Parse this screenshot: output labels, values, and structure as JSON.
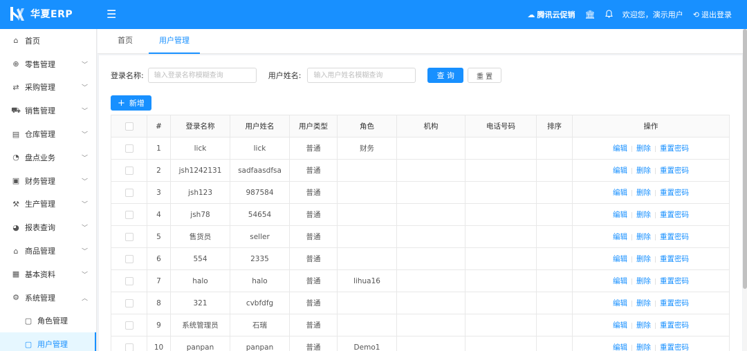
{
  "brand": {
    "name": "华夏ERP",
    "color": "#1890ff"
  },
  "header": {
    "promo_label": "腾讯云促销",
    "welcome": "欢迎您，演示用户",
    "logout_label": "退出登录"
  },
  "sidebar": {
    "items": [
      {
        "label": "首页",
        "icon": "home-icon",
        "has_arrow": false
      },
      {
        "label": "零售管理",
        "icon": "gift-icon",
        "has_arrow": true
      },
      {
        "label": "采购管理",
        "icon": "swap-icon",
        "has_arrow": true
      },
      {
        "label": "销售管理",
        "icon": "cart-icon",
        "has_arrow": true
      },
      {
        "label": "仓库管理",
        "icon": "warehouse-icon",
        "has_arrow": true
      },
      {
        "label": "盘点业务",
        "icon": "inventory-icon",
        "has_arrow": true
      },
      {
        "label": "财务管理",
        "icon": "finance-icon",
        "has_arrow": true
      },
      {
        "label": "生产管理",
        "icon": "wrench-icon",
        "has_arrow": true
      },
      {
        "label": "报表查询",
        "icon": "pie-chart-icon",
        "has_arrow": true
      },
      {
        "label": "商品管理",
        "icon": "shop-icon",
        "has_arrow": true
      },
      {
        "label": "基本资料",
        "icon": "grid-icon",
        "has_arrow": true
      },
      {
        "label": "系统管理",
        "icon": "gear-icon",
        "has_arrow": true,
        "expanded": true
      }
    ],
    "subitems": [
      {
        "label": "角色管理",
        "icon": "doc-icon",
        "active": false
      },
      {
        "label": "用户管理",
        "icon": "doc-icon",
        "active": true
      }
    ]
  },
  "tabs": [
    {
      "label": "首页",
      "active": false
    },
    {
      "label": "用户管理",
      "active": true
    }
  ],
  "search": {
    "login_label": "登录名称:",
    "login_placeholder": "输入登录名称模糊查询",
    "username_label": "用户姓名:",
    "username_placeholder": "输入用户姓名模糊查询",
    "query_label": "查 询",
    "reset_label": "重 置"
  },
  "add_label": "新增",
  "table": {
    "columns": [
      "#",
      "登录名称",
      "用户姓名",
      "用户类型",
      "角色",
      "机构",
      "电话号码",
      "排序",
      "操作"
    ],
    "actions": [
      "编辑",
      "删除",
      "重置密码"
    ],
    "rows": [
      {
        "idx": "1",
        "login": "lick",
        "name": "lick",
        "type": "普通",
        "role": "财务",
        "org": "",
        "phone": "",
        "sort": ""
      },
      {
        "idx": "2",
        "login": "jsh1242131",
        "name": "sadfaasdfsa",
        "type": "普通",
        "role": "",
        "org": "",
        "phone": "",
        "sort": ""
      },
      {
        "idx": "3",
        "login": "jsh123",
        "name": "987584",
        "type": "普通",
        "role": "",
        "org": "",
        "phone": "",
        "sort": ""
      },
      {
        "idx": "4",
        "login": "jsh78",
        "name": "54654",
        "type": "普通",
        "role": "",
        "org": "",
        "phone": "",
        "sort": ""
      },
      {
        "idx": "5",
        "login": "售货员",
        "name": "seller",
        "type": "普通",
        "role": "",
        "org": "",
        "phone": "",
        "sort": ""
      },
      {
        "idx": "6",
        "login": "554",
        "name": "2335",
        "type": "普通",
        "role": "",
        "org": "",
        "phone": "",
        "sort": ""
      },
      {
        "idx": "7",
        "login": "halo",
        "name": "halo",
        "type": "普通",
        "role": "lihua16",
        "org": "",
        "phone": "",
        "sort": ""
      },
      {
        "idx": "8",
        "login": "321",
        "name": "cvbfdfg",
        "type": "普通",
        "role": "",
        "org": "",
        "phone": "",
        "sort": ""
      },
      {
        "idx": "9",
        "login": "系统管理员",
        "name": "石瑞",
        "type": "普通",
        "role": "",
        "org": "",
        "phone": "",
        "sort": ""
      },
      {
        "idx": "10",
        "login": "panpan",
        "name": "panpan",
        "type": "普通",
        "role": "Demo1",
        "org": "",
        "phone": "",
        "sort": ""
      }
    ]
  }
}
